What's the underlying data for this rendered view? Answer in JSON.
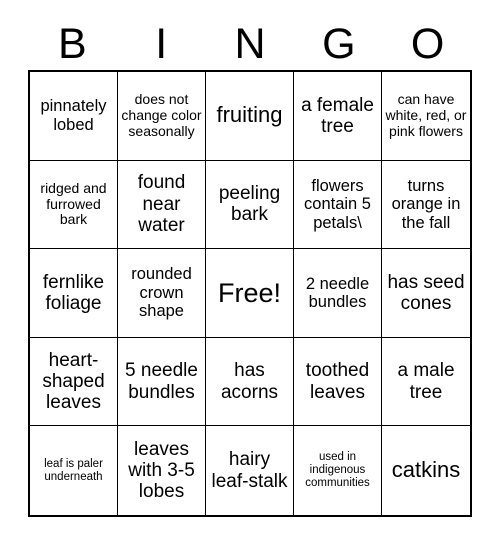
{
  "header": {
    "letters": [
      "B",
      "I",
      "N",
      "G",
      "O"
    ]
  },
  "grid": {
    "rows": 5,
    "columns": 5,
    "cells": [
      {
        "text": "pinnately lobed",
        "size": "sm"
      },
      {
        "text": "does not change color seasonally",
        "size": "xs"
      },
      {
        "text": "fruiting",
        "size": "lg"
      },
      {
        "text": "a female tree",
        "size": "md"
      },
      {
        "text": "can have white, red, or pink flowers",
        "size": "xs"
      },
      {
        "text": "ridged and furrowed bark",
        "size": "xs"
      },
      {
        "text": "found near water",
        "size": "md"
      },
      {
        "text": "peeling bark",
        "size": "md"
      },
      {
        "text": "flowers contain 5 petals\\",
        "size": "sm"
      },
      {
        "text": "turns orange in the fall",
        "size": "sm"
      },
      {
        "text": "fernlike foliage",
        "size": "md"
      },
      {
        "text": "rounded crown shape",
        "size": "sm"
      },
      {
        "text": "Free!",
        "size": "xl"
      },
      {
        "text": "2 needle bundles",
        "size": "sm"
      },
      {
        "text": "has seed cones",
        "size": "md"
      },
      {
        "text": "heart-shaped leaves",
        "size": "md"
      },
      {
        "text": "5 needle bundles",
        "size": "md"
      },
      {
        "text": "has acorns",
        "size": "md"
      },
      {
        "text": "toothed leaves",
        "size": "md"
      },
      {
        "text": "a male tree",
        "size": "md"
      },
      {
        "text": "leaf is paler underneath",
        "size": "xxs"
      },
      {
        "text": "leaves with 3-5 lobes",
        "size": "md"
      },
      {
        "text": "hairy leaf-stalk",
        "size": "md"
      },
      {
        "text": "used in indigenous communities",
        "size": "xxs"
      },
      {
        "text": "catkins",
        "size": "lg"
      }
    ]
  },
  "colors": {
    "background": "#ffffff",
    "text": "#000000",
    "grid_line": "#000000"
  }
}
